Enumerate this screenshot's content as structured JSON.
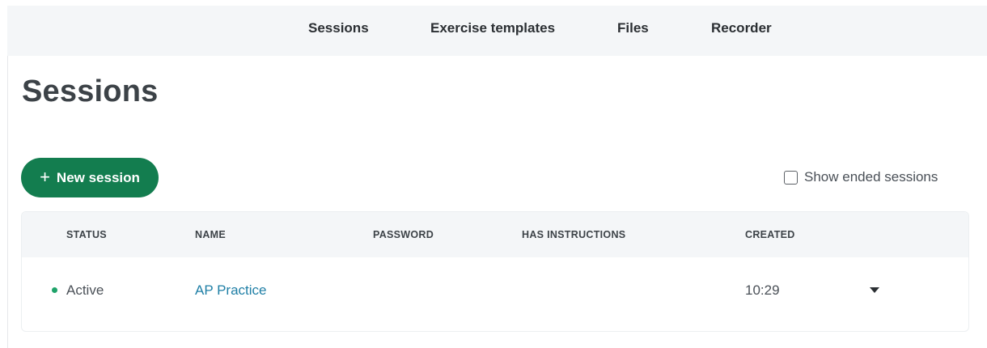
{
  "nav": {
    "items": [
      {
        "label": "Sessions"
      },
      {
        "label": "Exercise templates"
      },
      {
        "label": "Files"
      },
      {
        "label": "Recorder"
      }
    ]
  },
  "page": {
    "title": "Sessions"
  },
  "actions": {
    "new_session_label": "New session",
    "show_ended_label": "Show ended sessions",
    "show_ended_checked": false
  },
  "table": {
    "headers": {
      "status": "STATUS",
      "name": "NAME",
      "password": "PASSWORD",
      "has_instructions": "HAS INSTRUCTIONS",
      "created": "CREATED"
    },
    "rows": [
      {
        "status": "Active",
        "status_color": "#1fa36a",
        "name": "AP Practice",
        "password": "",
        "has_instructions": "",
        "created": "10:29"
      }
    ]
  },
  "colors": {
    "accent_button": "#137d4f",
    "link": "#1f7fa6",
    "nav_background": "#f4f6f8"
  },
  "icons": {
    "new_session": "plus-icon",
    "row_menu": "caret-down-icon",
    "status": "status-dot-icon"
  }
}
